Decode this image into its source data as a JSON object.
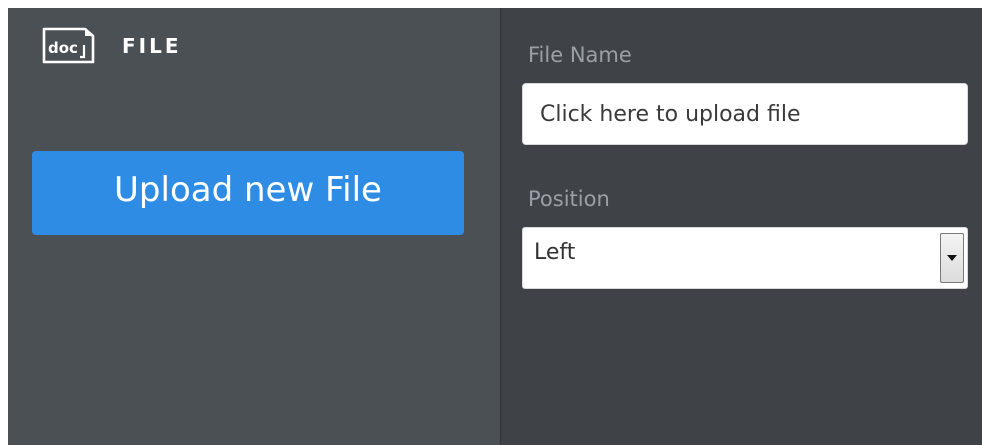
{
  "left_panel": {
    "icon_text": "doc",
    "title": "FILE",
    "upload_button_label": "Upload new File"
  },
  "right_panel": {
    "file_name": {
      "label": "File Name",
      "placeholder": "Click here to upload file",
      "value": ""
    },
    "position": {
      "label": "Position",
      "selected": "Left"
    }
  },
  "colors": {
    "left_panel_bg": "#4b5055",
    "right_panel_bg": "#3f4347",
    "accent_button": "#2f8ce4",
    "label_text": "#9aa0a6"
  },
  "icons": {
    "doc": "document-file-icon",
    "dropdown": "chevron-down-icon"
  }
}
